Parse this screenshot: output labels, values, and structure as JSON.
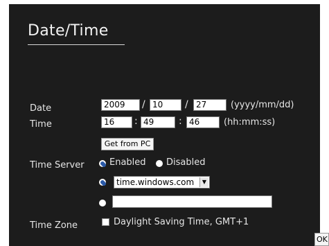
{
  "page": {
    "title": "Date/Time"
  },
  "date": {
    "label": "Date",
    "year": "2009",
    "month": "10",
    "day": "27",
    "separator": "/",
    "format": "(yyyy/mm/dd)"
  },
  "time": {
    "label": "Time",
    "hour": "16",
    "minute": "49",
    "second": "46",
    "separator": ":",
    "format": "(hh:mm:ss)"
  },
  "get_from_pc": "Get from PC",
  "time_server": {
    "label": "Time Server",
    "enabled_label": "Enabled",
    "disabled_label": "Disabled",
    "selected_mode": "Enabled",
    "server_option": "time.windows.com",
    "custom_server": ""
  },
  "time_zone": {
    "label": "Time Zone",
    "checkbox_label": "Daylight Saving Time, GMT+1",
    "checked": false
  },
  "ok_label": "OK",
  "colors": {
    "panel_bg": "#1c1c1c",
    "text": "#e6e6e6",
    "radio_selected": "#2b5aa8"
  }
}
